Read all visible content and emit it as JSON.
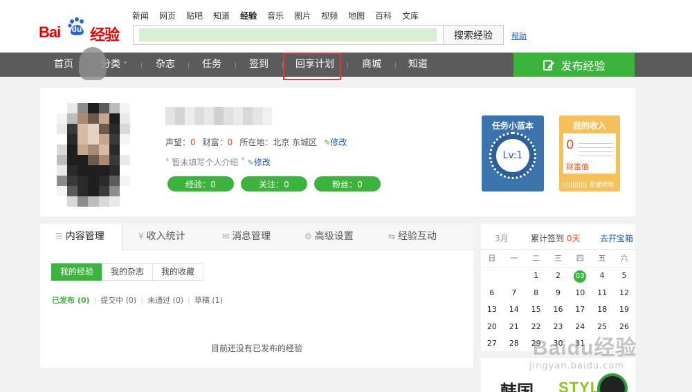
{
  "logo": {
    "bai": "Bai",
    "du": "du",
    "jingyan": "经验"
  },
  "top_nav": [
    "新闻",
    "网页",
    "贴吧",
    "知道",
    "经验",
    "音乐",
    "图片",
    "视频",
    "地图",
    "百科",
    "文库"
  ],
  "top_nav_active": "经验",
  "search": {
    "button": "搜索经验",
    "help": "帮助"
  },
  "main_nav": [
    "首页",
    "分类",
    "杂志",
    "任务",
    "签到",
    "回享计划",
    "商城",
    "知道"
  ],
  "publish_button": "发布经验",
  "profile": {
    "reputation_label": "声望：",
    "reputation": "0",
    "wealth_label": "财富：",
    "wealth": "0",
    "location_label": "所在地：",
    "location": "北京 东城区",
    "edit": "修改",
    "intro": "暂未填写个人介绍",
    "experience_pill": "经验：0",
    "follow_pill": "关注：0",
    "fans_pill": "粉丝：0"
  },
  "task_book": {
    "title": "任务小蓝本",
    "level": "Lv:1"
  },
  "income": {
    "title": "我的收入",
    "value": "0",
    "label": "财富值",
    "footer": "百度经验"
  },
  "tabs": [
    "内容管理",
    "收入统计",
    "消息管理",
    "高级设置",
    "经验互动"
  ],
  "sub_tabs": [
    "我的经验",
    "我的杂志",
    "我的收藏"
  ],
  "filters": [
    {
      "label": "已发布 (0)",
      "active": true
    },
    {
      "label": "提交中 (0)",
      "active": false
    },
    {
      "label": "未通过 (0)",
      "active": false
    },
    {
      "label": "草稿 (1)",
      "active": false
    }
  ],
  "empty_message": "目前还没有已发布的经验",
  "calendar": {
    "month": "3月",
    "signin_prefix": "累计签到",
    "signin_days": "0天",
    "treasure": "去开宝箱",
    "weekdays": [
      "日",
      "一",
      "二",
      "三",
      "四",
      "五",
      "六"
    ],
    "weeks": [
      [
        "",
        "",
        "",
        "1",
        "2",
        "03",
        "4",
        "5"
      ],
      [
        "6",
        "7",
        "8",
        "9",
        "10",
        "11",
        "12"
      ],
      [
        "13",
        "14",
        "15",
        "16",
        "17",
        "18",
        "19"
      ],
      [
        "20",
        "21",
        "22",
        "23",
        "24",
        "25",
        "26"
      ],
      [
        "27",
        "28",
        "29",
        "30",
        "31",
        "",
        ""
      ]
    ],
    "today": "03"
  },
  "ad": {
    "text1": "韩国",
    "text2": "STYLE"
  },
  "watermark": {
    "brand": "Baidu经验",
    "url": "jingyan.baidu.com"
  }
}
